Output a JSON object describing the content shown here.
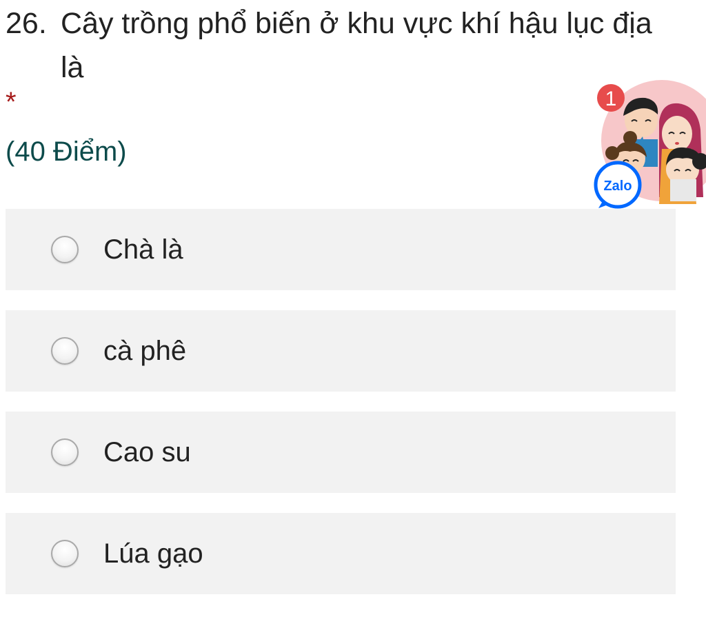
{
  "question": {
    "number": "26.",
    "text": "Cây trồng phổ biến ở khu vực khí hậu lục địa là",
    "required_marker": "*",
    "points": "(40 Điểm)"
  },
  "options": [
    {
      "label": "Chà là",
      "selected": false
    },
    {
      "label": "cà phê",
      "selected": false
    },
    {
      "label": "Cao su",
      "selected": false
    },
    {
      "label": "Lúa gạo",
      "selected": false
    }
  ],
  "zalo_widget": {
    "badge_count": "1",
    "brand_label": "Zalo",
    "colors": {
      "badge": "#e74c4c",
      "brand": "#0068ff",
      "background": "#f7c7c9"
    }
  }
}
